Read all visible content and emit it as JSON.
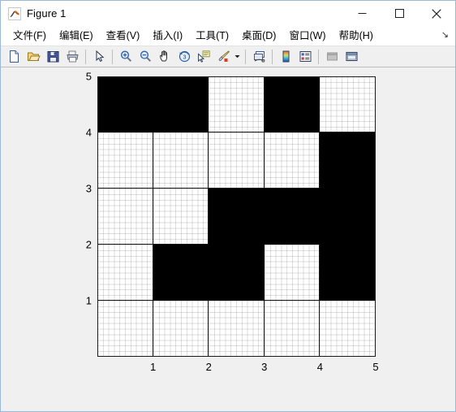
{
  "window": {
    "title": "Figure 1",
    "app_icon": "matlab-membrane-icon",
    "controls": {
      "minimize": "minimize-icon",
      "maximize": "maximize-icon",
      "close": "close-icon"
    }
  },
  "menubar": {
    "items": [
      {
        "label": "文件(F)",
        "name": "menu-file"
      },
      {
        "label": "编辑(E)",
        "name": "menu-edit"
      },
      {
        "label": "查看(V)",
        "name": "menu-view"
      },
      {
        "label": "插入(I)",
        "name": "menu-insert"
      },
      {
        "label": "工具(T)",
        "name": "menu-tools"
      },
      {
        "label": "桌面(D)",
        "name": "menu-desktop"
      },
      {
        "label": "窗口(W)",
        "name": "menu-window"
      },
      {
        "label": "帮助(H)",
        "name": "menu-help"
      }
    ],
    "overflow_glyph": "↘"
  },
  "toolbar": {
    "buttons": [
      "new-figure-icon",
      "open-file-icon",
      "save-figure-icon",
      "print-figure-icon",
      "pointer-icon",
      "zoom-in-icon",
      "zoom-out-icon",
      "pan-icon",
      "rotate-3d-icon",
      "data-cursor-icon",
      "brush-icon",
      "link-plot-icon",
      "colorbar-icon",
      "legend-icon",
      "hide-plot-tools-icon",
      "show-plot-tools-icon"
    ]
  },
  "chart_data": {
    "type": "heatmap",
    "title": "",
    "xlabel": "",
    "ylabel": "",
    "xlim": [
      0,
      5
    ],
    "ylim": [
      0,
      5
    ],
    "xticks": [
      "1",
      "2",
      "3",
      "4",
      "5"
    ],
    "yticks": [
      "1",
      "2",
      "3",
      "4",
      "5"
    ],
    "grid": true,
    "colors": {
      "on": "#000000",
      "off": "#ffffff"
    },
    "legend": "none",
    "note": "5x5 binary cell grid; rows listed top (y 4-5) to bottom (y 0-1), columns left (x 0-1) to right (x 4-5). 1 = black filled cell, 0 = white cell.",
    "rows_top_to_bottom": [
      [
        1,
        1,
        0,
        1,
        0
      ],
      [
        0,
        0,
        0,
        0,
        1
      ],
      [
        0,
        0,
        1,
        1,
        1
      ],
      [
        0,
        1,
        1,
        0,
        1
      ],
      [
        0,
        0,
        0,
        0,
        0
      ]
    ]
  }
}
